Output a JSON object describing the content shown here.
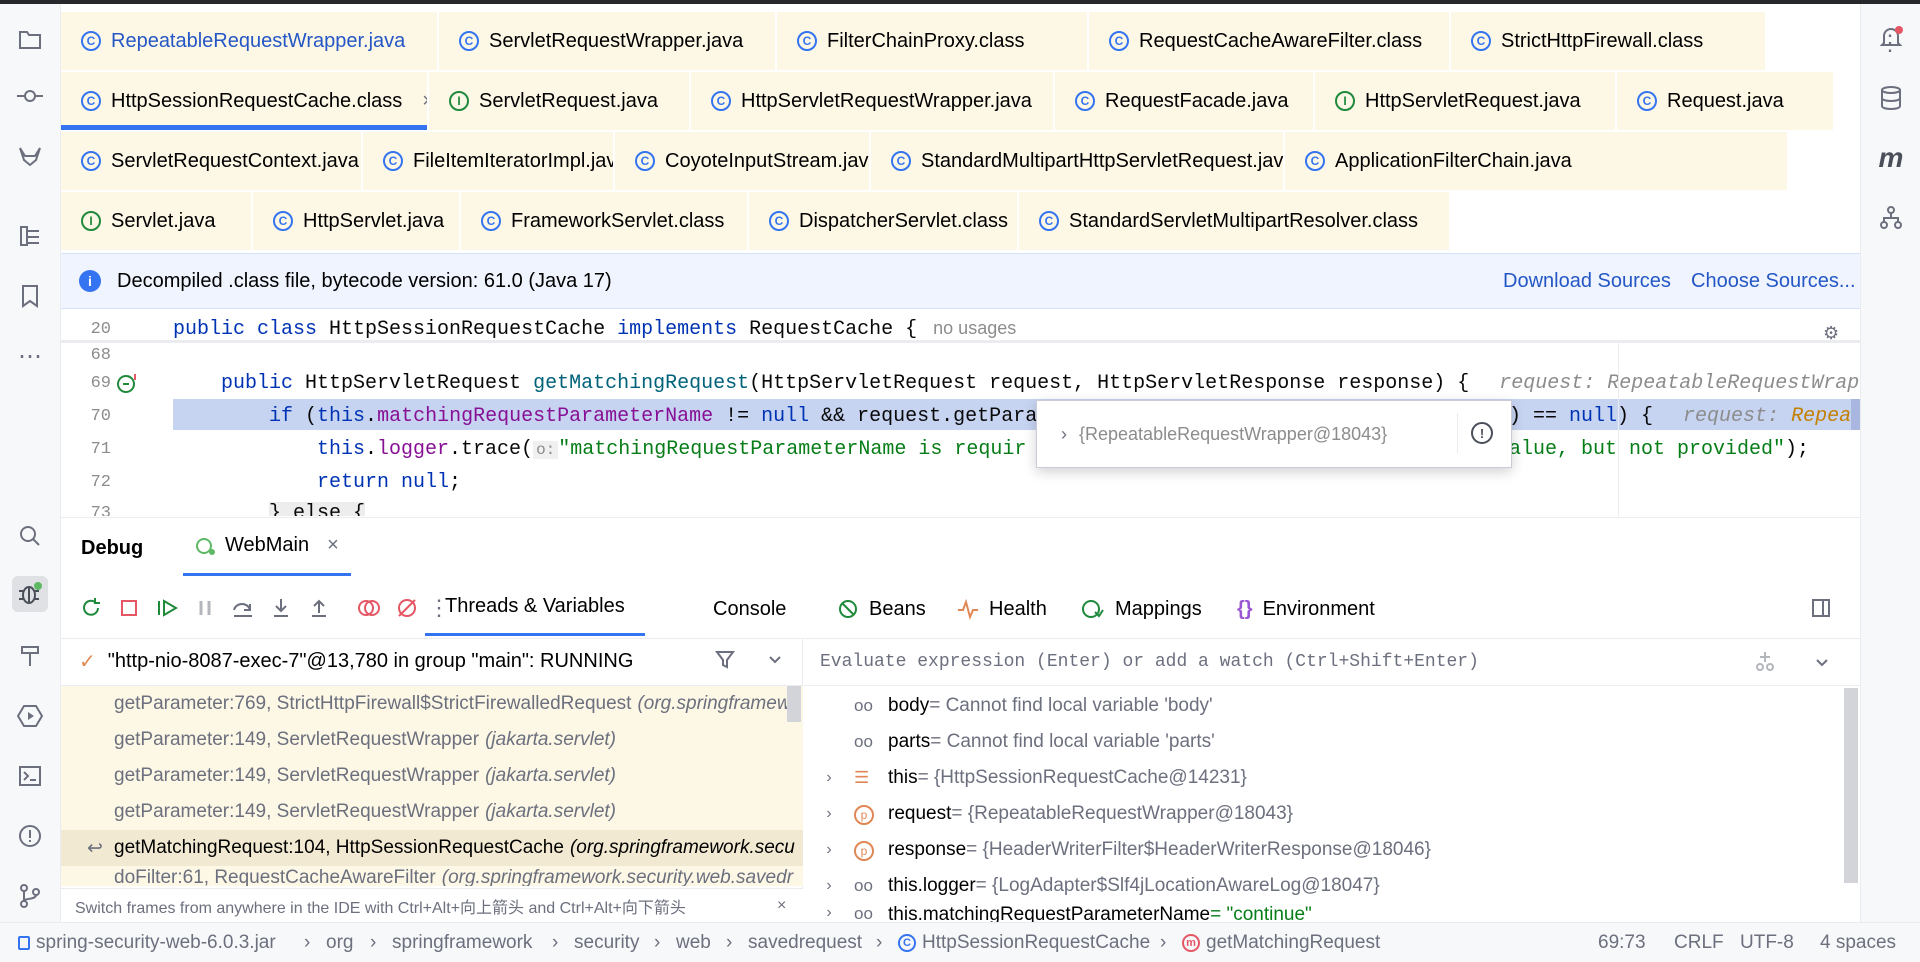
{
  "file_tabs": [
    [
      "RepeatableRequestWrapper.java",
      "ServletRequestWrapper.java",
      "FilterChainProxy.class",
      "RequestCacheAwareFilter.class",
      "StrictHttpFirewall.class"
    ],
    [
      "HttpSessionRequestCache.class",
      "ServletRequest.java",
      "HttpServletRequestWrapper.java",
      "RequestFacade.java",
      "HttpServletRequest.java",
      "Request.java"
    ],
    [
      "ServletRequestContext.java",
      "FileItemIteratorImpl.java",
      "CoyoteInputStream.java",
      "StandardMultipartHttpServletRequest.java",
      "ApplicationFilterChain.java"
    ],
    [
      "Servlet.java",
      "HttpServlet.java",
      "FrameworkServlet.class",
      "DispatcherServlet.class",
      "StandardServletMultipartResolver.class"
    ]
  ],
  "tab_close": "×",
  "tab_menu": "⋮",
  "banner": {
    "text": "Decompiled .class file, bytecode version: 61.0 (Java 17)",
    "download": "Download Sources",
    "choose": "Choose Sources..."
  },
  "editor": {
    "line_numbers": [
      "20",
      "68",
      "69",
      "70",
      "71",
      "72",
      "73"
    ],
    "l20_kw1": "public class",
    "l20_name": " HttpSessionRequestCache ",
    "l20_kw2": "implements",
    "l20_rest": " RequestCache {",
    "l20_hint": "no usages",
    "l69_kw": "public",
    "l69_a": " HttpServletRequest ",
    "l69_m": "getMatchingRequest",
    "l69_b": "(HttpServletRequest request, HttpServletResponse response) {",
    "l69_hint": "request: RepeatableRequestWrap",
    "l70_kw": "if",
    "l70_a": " (",
    "l70_this": "this",
    "l70_dot": ".",
    "l70_fld": "matchingRequestParameterName",
    "l70_b": " != ",
    "l70_null": "null",
    "l70_c": " && request.getPara",
    "l70_d": ") == ",
    "l70_null2": "null",
    "l70_e": ") {",
    "l70_hint1": "request: ",
    "l70_hint2": "Repea",
    "l71_this": "this",
    "l71_dot": ".",
    "l71_fld": "logger",
    "l71_a": ".trace(",
    "l71_o": "o:",
    "l71_str": "\"matchingRequestParameterName is requir",
    "l71_str2": "alue, but not provided\"",
    "l71_end": ");",
    "l72_kw": "return",
    "l72_null": "null",
    "l72_end": ";",
    "l73": "} else {",
    "tooltip_value": "{RepeatableRequestWrapper@18043}"
  },
  "debug": {
    "title": "Debug",
    "session": "WebMain",
    "panel_tabs": [
      "Threads & Variables",
      "Console",
      "Beans",
      "Health",
      "Mappings",
      "Environment"
    ],
    "thread": "\"http-nio-8087-exec-7\"@13,780 in group \"main\": RUNNING",
    "frames": [
      {
        "m": "getParameter:769, StrictHttpFirewall$StrictFirewalledRequest",
        "p": "(org.springframew"
      },
      {
        "m": "getParameter:149, ServletRequestWrapper",
        "p": "(jakarta.servlet)"
      },
      {
        "m": "getParameter:149, ServletRequestWrapper",
        "p": "(jakarta.servlet)"
      },
      {
        "m": "getParameter:149, ServletRequestWrapper",
        "p": "(jakarta.servlet)"
      },
      {
        "m": "getMatchingRequest:104, HttpSessionRequestCache",
        "p": "(org.springframework.secu"
      },
      {
        "m": "doFilter:61, RequestCacheAwareFilter",
        "p": "(org.springframework.security.web.savedr"
      }
    ],
    "frames_hint": "Switch frames from anywhere in the IDE with Ctrl+Alt+向上箭头 and Ctrl+Alt+向下箭头",
    "eval_placeholder": "Evaluate expression (Enter) or add a watch (Ctrl+Shift+Enter)",
    "vars": [
      {
        "n": "body",
        "v": " = Cannot find local variable 'body'"
      },
      {
        "n": "parts",
        "v": " = Cannot find local variable 'parts'"
      },
      {
        "n": "this",
        "v": " = {HttpSessionRequestCache@14231}"
      },
      {
        "n": "request",
        "v": " = {RepeatableRequestWrapper@18043}"
      },
      {
        "n": "response",
        "v": " = {HeaderWriterFilter$HeaderWriterResponse@18046}"
      },
      {
        "n": "this.logger",
        "v": " = {LogAdapter$Slf4jLocationAwareLog@18047}"
      },
      {
        "n": "this.matchingRequestParameterName",
        "v": " = \"continue\""
      }
    ]
  },
  "status": {
    "breadcrumb": [
      "spring-security-web-6.0.3.jar",
      "org",
      "springframework",
      "security",
      "web",
      "savedrequest",
      "HttpSessionRequestCache",
      "getMatchingRequest"
    ],
    "sep": "›",
    "position": "69:73",
    "line_sep": "CRLF",
    "encoding": "UTF-8",
    "indent": "4 spaces"
  },
  "icons": {
    "class_tab": "class-icon",
    "interface_tab": "interface-icon",
    "method": "method-icon"
  },
  "colors": {
    "accent": "#3574f0",
    "tab_bg": "#fdf7e6",
    "selection": "#c6d4f2",
    "breakpoint": "#e55765"
  }
}
